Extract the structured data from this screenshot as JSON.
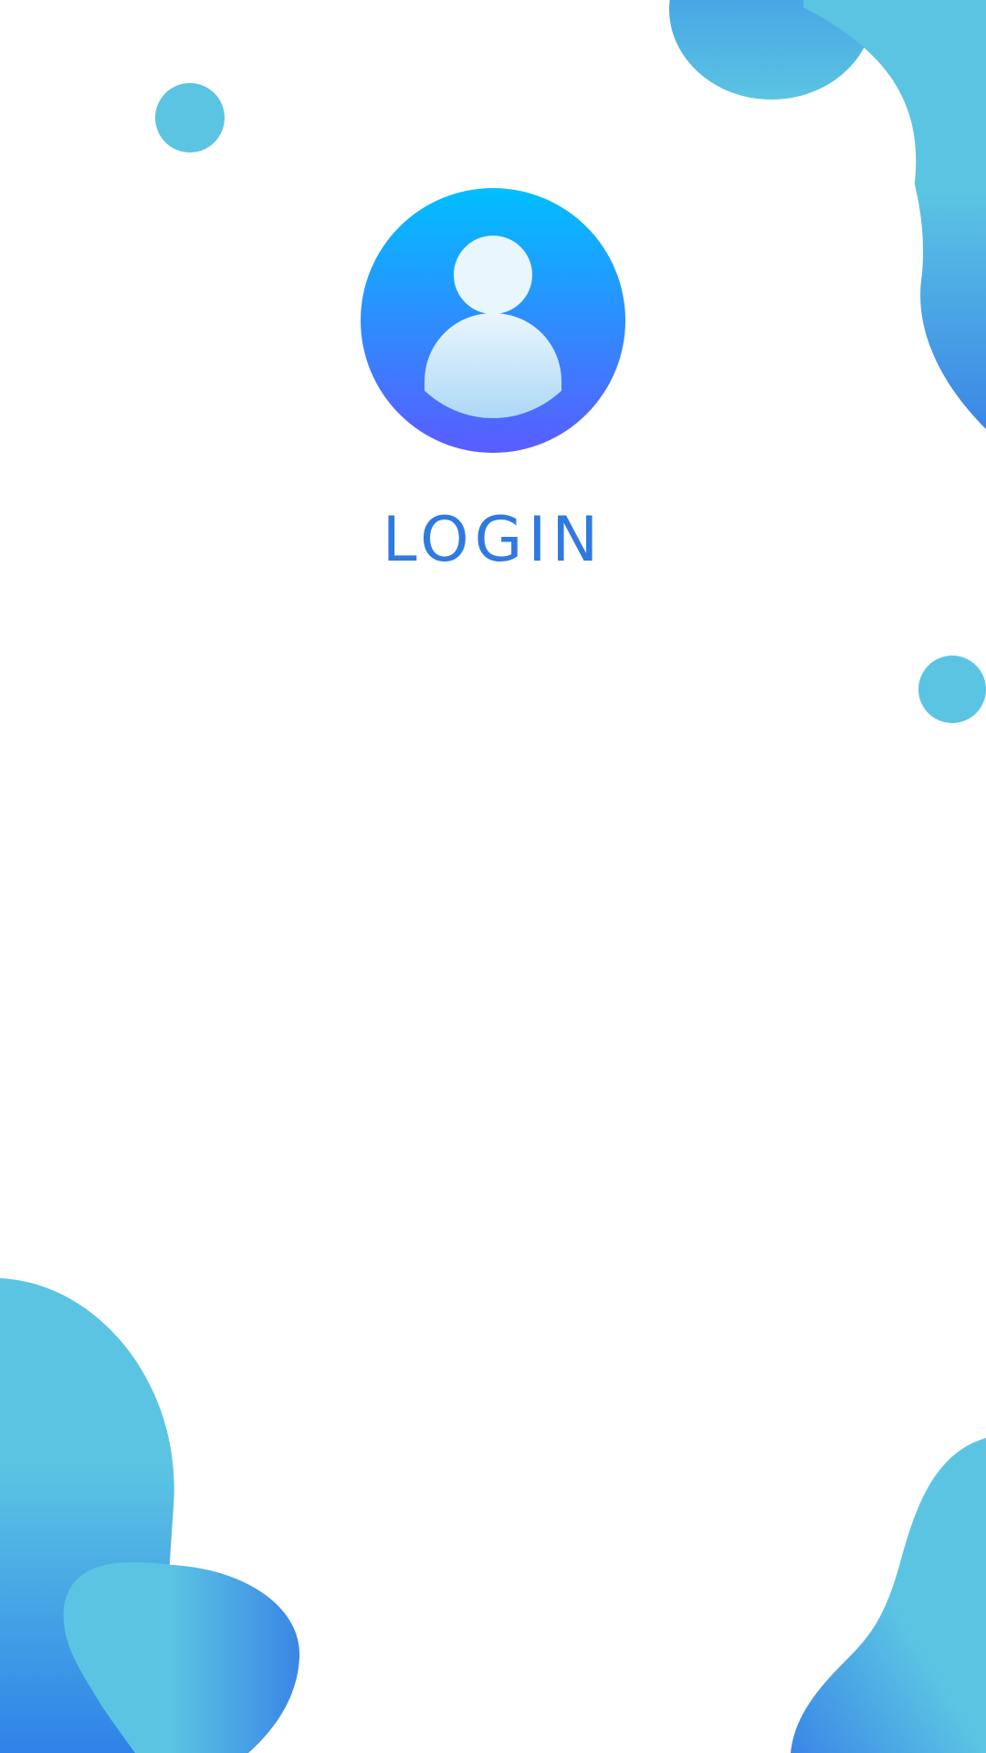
{
  "screen": {
    "title": "LOGIN",
    "avatar_icon": "user-avatar-icon"
  },
  "colors": {
    "title": "#2f7ae0",
    "blob_light": "#5bc4e3",
    "blob_dark": "#3a86e6",
    "avatar_top": "#00bfff",
    "avatar_bottom": "#5a5cff",
    "figure_light": "#eaf6fd",
    "figure_bottom": "#add8f7"
  }
}
